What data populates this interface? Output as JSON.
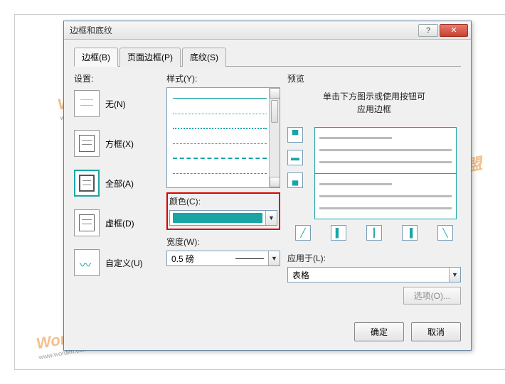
{
  "title": "边框和底纹",
  "tabs": [
    {
      "label": "边框(B)",
      "active": true
    },
    {
      "label": "页面边框(P)",
      "active": false
    },
    {
      "label": "底纹(S)",
      "active": false
    }
  ],
  "settings": {
    "label": "设置:",
    "items": [
      {
        "key": "none",
        "label": "无(N)"
      },
      {
        "key": "box",
        "label": "方框(X)"
      },
      {
        "key": "all",
        "label": "全部(A)",
        "selected": true
      },
      {
        "key": "grid",
        "label": "虚框(D)"
      },
      {
        "key": "custom",
        "label": "自定义(U)"
      }
    ]
  },
  "style": {
    "label": "样式(Y):"
  },
  "color": {
    "label": "颜色(C):",
    "value": "#1aa5a5"
  },
  "width": {
    "label": "宽度(W):",
    "value": "0.5 磅"
  },
  "preview": {
    "label": "预览",
    "hint1": "单击下方图示或使用按钮可",
    "hint2": "应用边框"
  },
  "apply_to": {
    "label": "应用于(L):",
    "value": "表格"
  },
  "options_btn": "选项(O)...",
  "ok": "确定",
  "cancel": "取消",
  "watermark": {
    "brand": "Word联盟",
    "url": "www.wordlm.com"
  }
}
